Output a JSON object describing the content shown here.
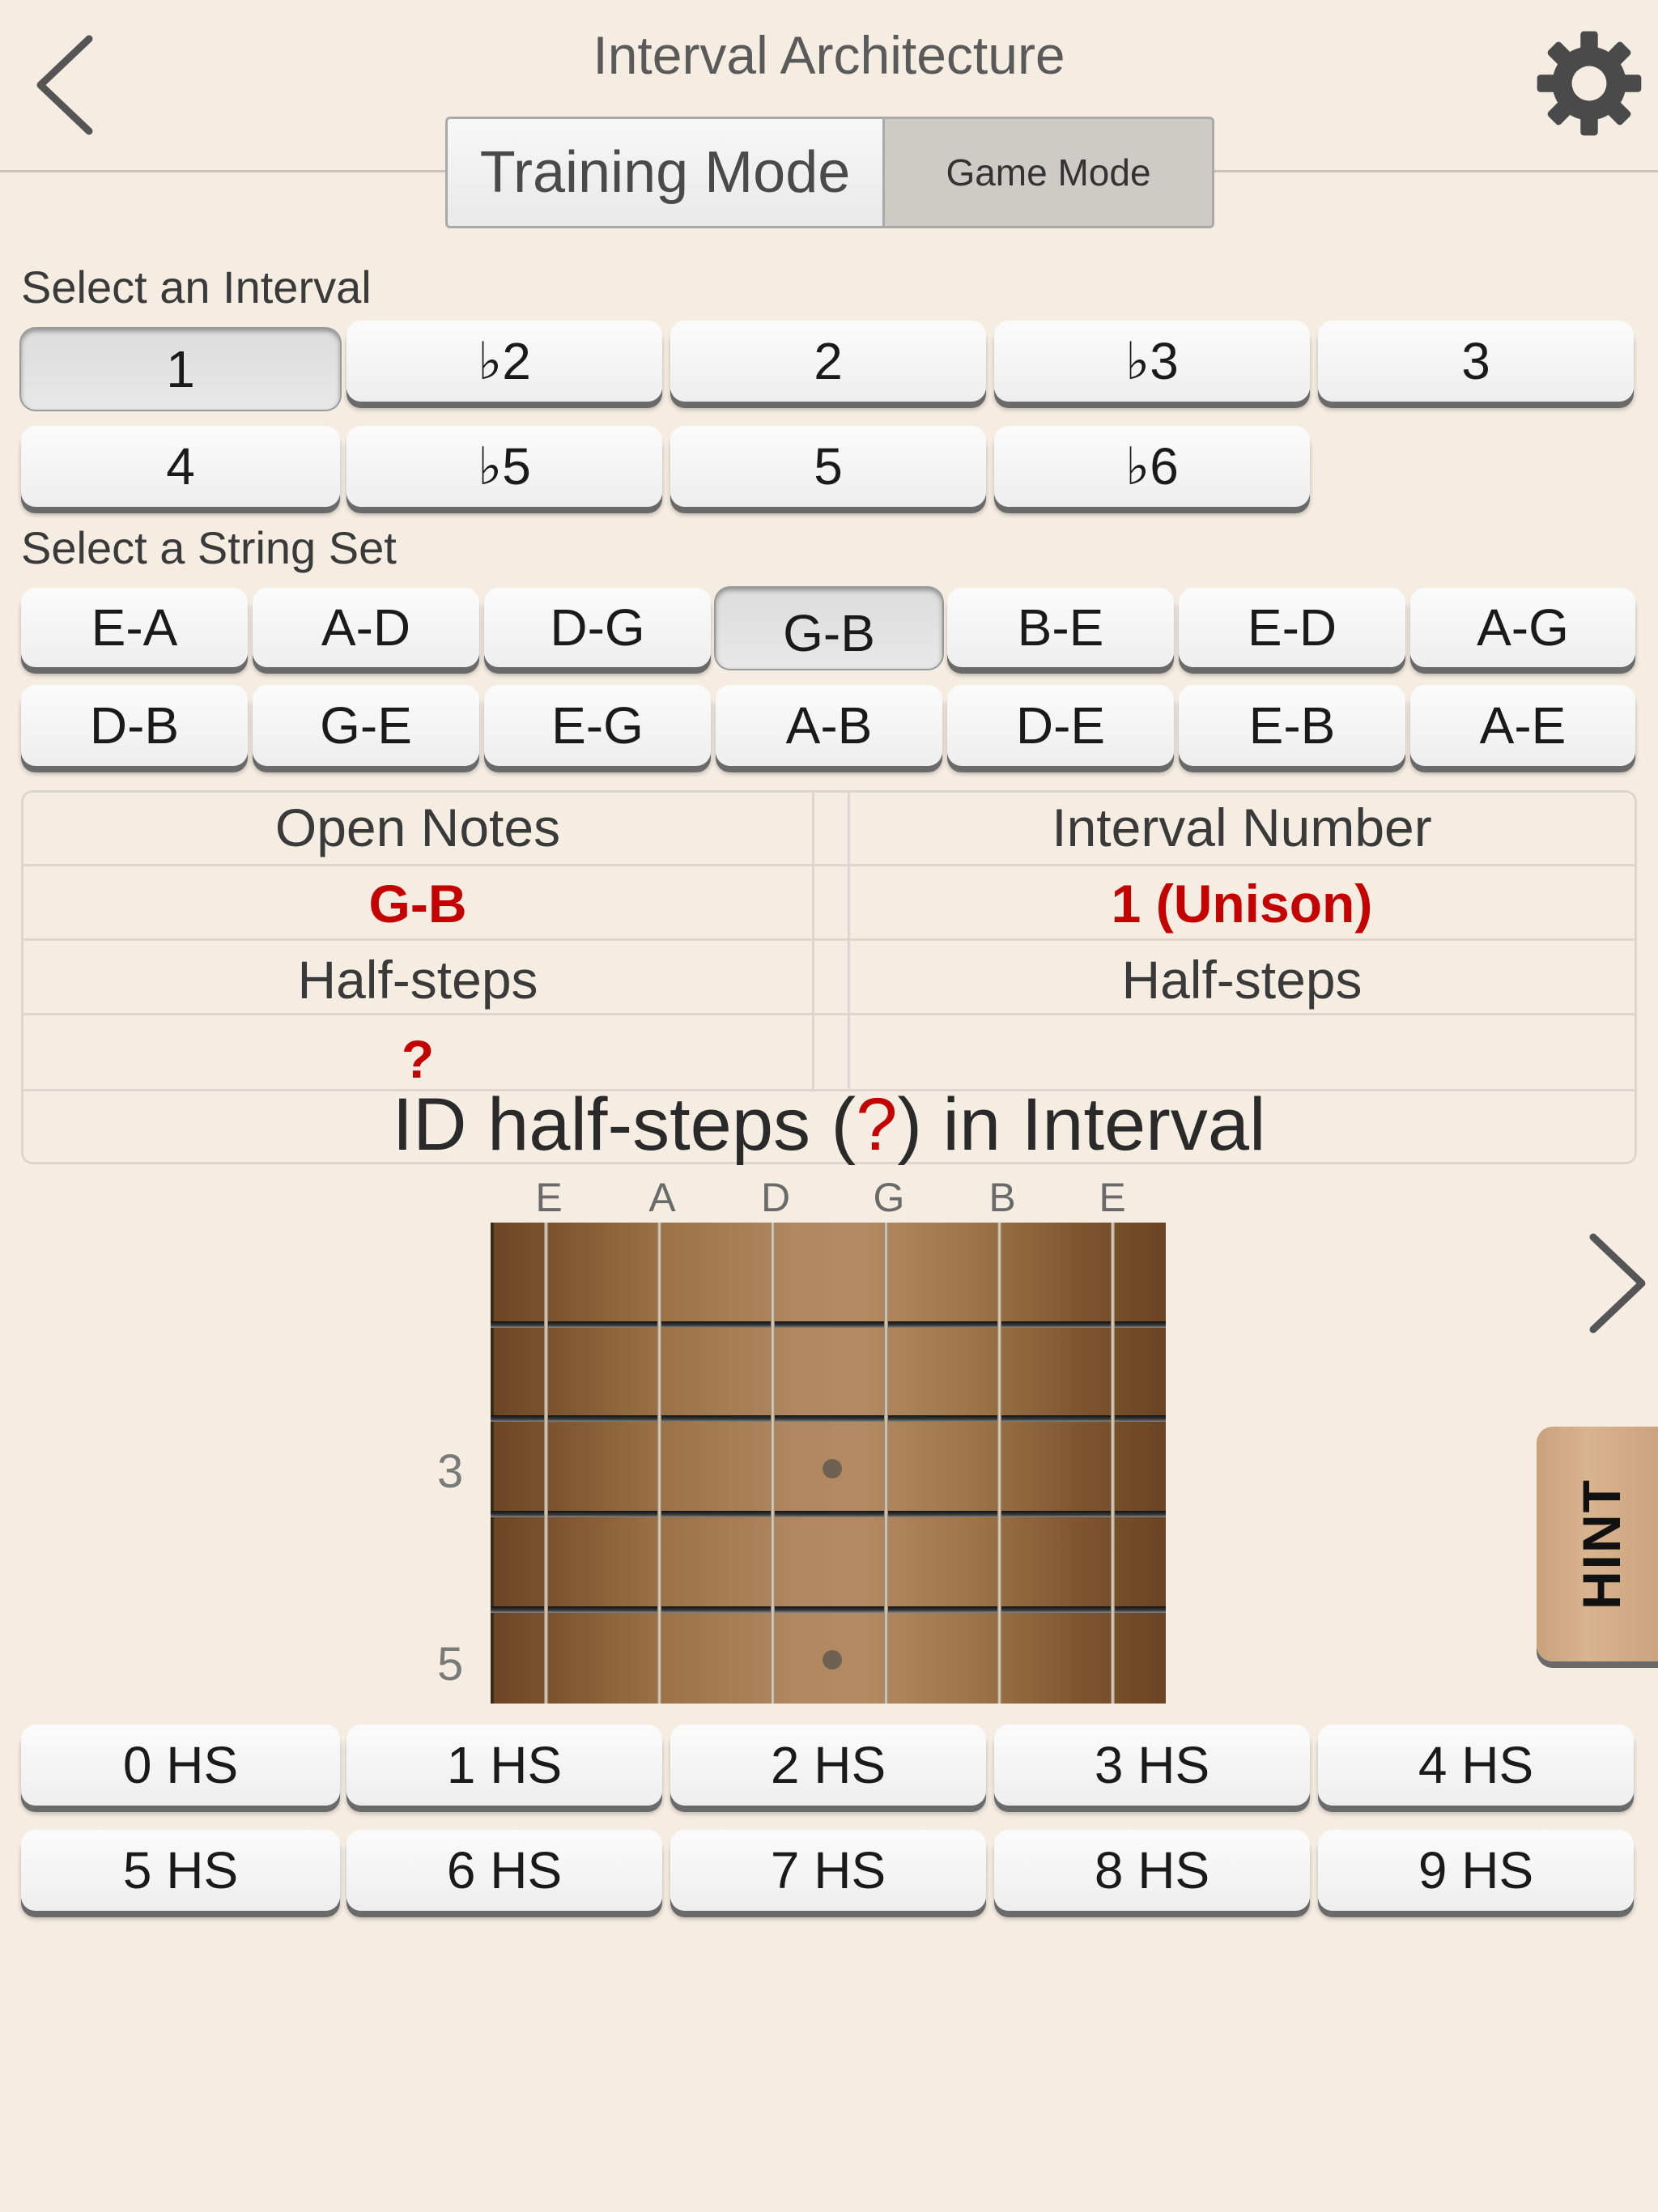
{
  "header": {
    "title": "Interval Architecture",
    "back_icon": "chevron-left-icon",
    "settings_icon": "gear-icon"
  },
  "mode_toggle": {
    "training_label": "Training Mode",
    "game_label": "Game Mode",
    "selected": "training"
  },
  "intervals": {
    "label": "Select an Interval",
    "items": [
      "1",
      "♭2",
      "2",
      "♭3",
      "3",
      "4",
      "♭5",
      "5",
      "♭6"
    ],
    "selected": "1"
  },
  "string_sets": {
    "label": "Select a String Set",
    "items": [
      "E-A",
      "A-D",
      "D-G",
      "G-B",
      "B-E",
      "E-D",
      "A-G",
      "D-B",
      "G-E",
      "E-G",
      "A-B",
      "D-E",
      "E-B",
      "A-E"
    ],
    "selected": "G-B"
  },
  "info": {
    "open_notes_header": "Open Notes",
    "open_notes_value": "G-B",
    "left_halfsteps_header": "Half-steps",
    "left_halfsteps_value": "?",
    "interval_number_header": "Interval Number",
    "interval_number_value": "1 (Unison)",
    "right_halfsteps_header": "Half-steps",
    "right_halfsteps_value": "",
    "prompt_before": "ID half-steps (",
    "prompt_mark": "?",
    "prompt_after": ") in Interval"
  },
  "fretboard": {
    "strings": [
      "E",
      "A",
      "D",
      "G",
      "B",
      "E"
    ],
    "fret_numbers": [
      "3",
      "5"
    ]
  },
  "next_icon": "chevron-right-icon",
  "hint_label": "HINT",
  "halfstep_answers": [
    "0 HS",
    "1 HS",
    "2 HS",
    "3 HS",
    "4 HS",
    "5 HS",
    "6 HS",
    "7 HS",
    "8 HS",
    "9 HS"
  ],
  "colors": {
    "background": "#f5ede2",
    "accent_red": "#c40000",
    "hint_tab": "#d2ae88"
  }
}
